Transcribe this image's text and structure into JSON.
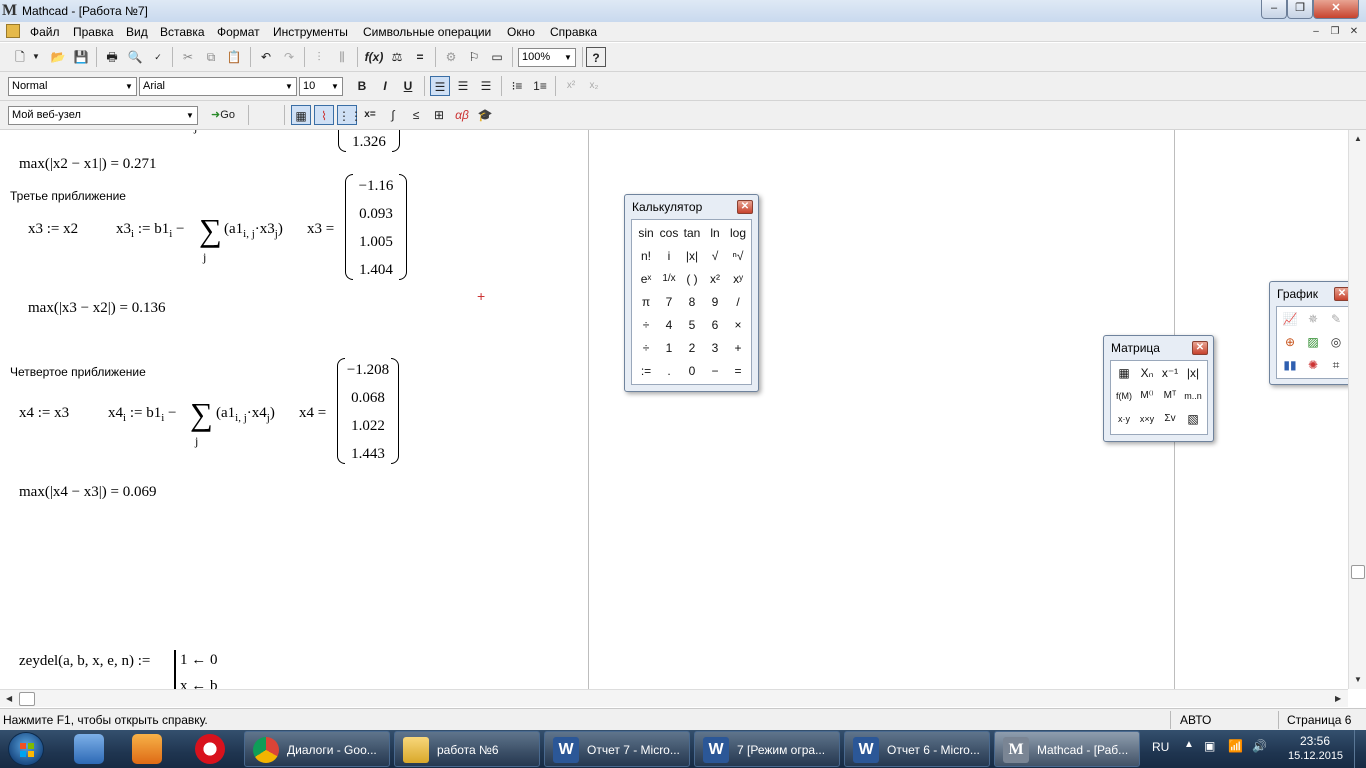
{
  "window": {
    "title": "Mathcad - [Работа №7]",
    "logo": "M"
  },
  "menu": [
    "Файл",
    "Правка",
    "Вид",
    "Вставка",
    "Формат",
    "Инструменты",
    "Символьные операции",
    "Окно",
    "Справка"
  ],
  "toolbar": {
    "zoom": "100%"
  },
  "format_bar": {
    "style": "Normal",
    "font": "Arial",
    "size": "10",
    "bold": "B",
    "italic": "I",
    "underline": "U",
    "superscript": "x²",
    "subscript": "x₂"
  },
  "web_bar": {
    "address": "Мой веб-узел",
    "go_label": "Go"
  },
  "document": {
    "top_sub": "j",
    "top_matrix_last": "1.326",
    "max1": "max(|x2 − x1|) = 0.271",
    "label3": "Третье приближение",
    "assign3": "x3 := x2",
    "iter3_lhs": "x3",
    "iter3_idx": "i",
    "iter3_mid": ":= b1",
    "iter3_mid_idx": "i",
    "iter3_minus": "−",
    "iter3_sum_idx": "j",
    "iter3_term": "a1",
    "iter3_term_idx": "i, j",
    "iter3_term2": "·x3",
    "iter3_term2_idx": "j",
    "iter3_res": "x3 =",
    "x3_values": [
      "−1.16",
      "0.093",
      "1.005",
      "1.404"
    ],
    "max2": "max(|x3 − x2|) = 0.136",
    "label4": "Четвертое приближение",
    "assign4": "x4 := x3",
    "iter4_lhs": "x4",
    "iter4_term2": "·x4",
    "iter4_res": "x4 =",
    "x4_values": [
      "−1.208",
      "0.068",
      "1.022",
      "1.443"
    ],
    "max3": "max(|x4 − x3|) = 0.069",
    "func_def": "zeydel(a, b, x, e, n) :=",
    "func_line1": "1 ← 0",
    "func_line2": "x ← b"
  },
  "status": {
    "help": "Нажмите F1, чтобы открыть справку.",
    "mode": "АВТО",
    "page": "Страница 6"
  },
  "calc_palette": {
    "title": "Калькулятор",
    "keys": [
      [
        "sin",
        "cos",
        "tan",
        "ln",
        "log"
      ],
      [
        "n!",
        "i",
        "|x|",
        "√",
        "ⁿ√"
      ],
      [
        "eˣ",
        "1/x",
        "( )",
        "x²",
        "xʸ"
      ],
      [
        "π",
        "7",
        "8",
        "9",
        "/"
      ],
      [
        "÷",
        "4",
        "5",
        "6",
        "×"
      ],
      [
        "÷",
        "1",
        "2",
        "3",
        "+"
      ],
      [
        ":=",
        ".",
        "0",
        "−",
        "="
      ]
    ]
  },
  "matrix_palette": {
    "title": "Матрица",
    "keys": [
      [
        "▦",
        "Xₙ",
        "x⁻¹",
        "|x|"
      ],
      [
        "f(M)",
        "M⁽⁾",
        "Mᵀ",
        "m..n"
      ],
      [
        "x·y",
        "x×y",
        "Σv",
        "▧"
      ]
    ]
  },
  "graph_palette": {
    "title": "График"
  },
  "taskbar": {
    "tasks": [
      "Диалоги - Goo...",
      "работа №6",
      "Отчет 7 - Micro...",
      "7 [Режим огра...",
      "Отчет 6 - Micro...",
      "Mathcad - [Раб..."
    ],
    "lang": "RU",
    "time": "23:56",
    "date": "15.12.2015"
  },
  "colors": {
    "accent": "#3a6ea5",
    "taskbar": "#1f3550",
    "close": "#c7432e"
  }
}
